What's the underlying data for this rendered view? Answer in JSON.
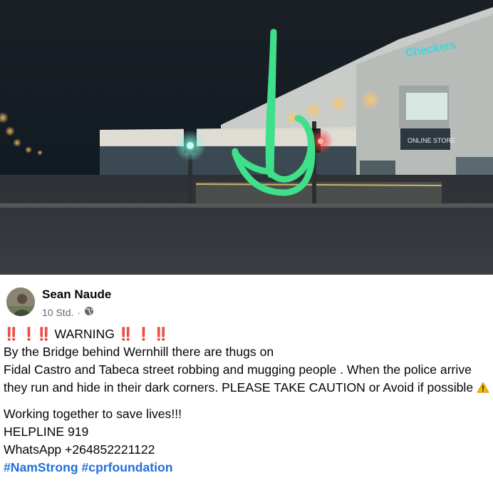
{
  "photo": {
    "sign_text": "Checkers",
    "sign_color": "#3cd6e0",
    "arrow_color": "#3fe08a"
  },
  "post": {
    "author": "Sean Naude",
    "time": "10 Std.",
    "separator": "·",
    "privacy_icon": "globe-icon",
    "warning_prefix": "‼️ ❗‼️",
    "warning_word": "WARNING",
    "warning_suffix": "‼️ ❗ ‼️",
    "line1": "By the Bridge behind Wernhill there are thugs on",
    "line2": "Fidal Castro and Tabeca street robbing and mugging people . When the police arrive they run and hide in their dark corners. PLEASE TAKE CAUTION or Avoid if possible",
    "caution_icon": "warning-sign-icon",
    "closing": "Working together to save lives!!!",
    "helpline": "HELPLINE 919",
    "whatsapp": "WhatsApp +264852221122",
    "hashtag1": "#NamStrong",
    "hashtag2": "#cprfoundation",
    "hashtag_color": "#216fdb"
  }
}
